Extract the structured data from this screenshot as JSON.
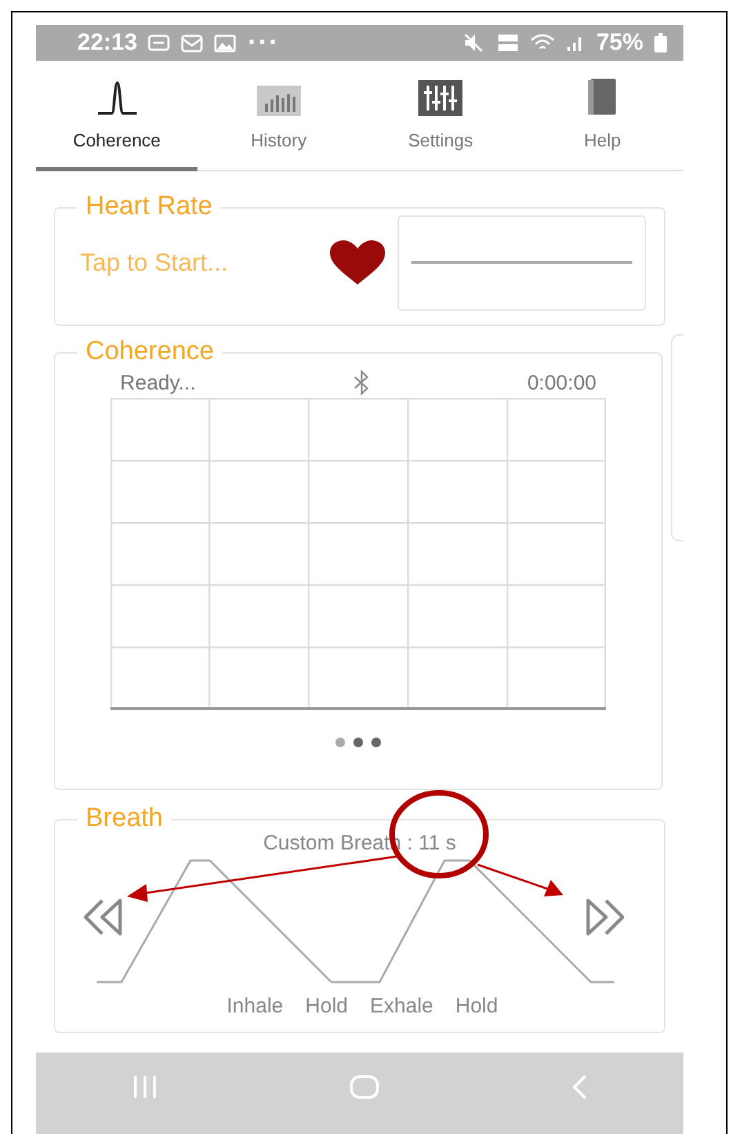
{
  "status_bar": {
    "time": "22:13",
    "more": "···",
    "battery": "75%"
  },
  "tabs": [
    {
      "label": "Coherence",
      "selected": true
    },
    {
      "label": "History",
      "selected": false
    },
    {
      "label": "Settings",
      "selected": false
    },
    {
      "label": "Help",
      "selected": false
    }
  ],
  "heart_rate": {
    "title": "Heart Rate",
    "status": "Tap to Start..."
  },
  "coherence": {
    "title": "Coherence",
    "status": "Ready...",
    "timer": "0:00:00",
    "pages": [
      {
        "selected": true
      },
      {
        "selected": false
      },
      {
        "selected": false
      }
    ]
  },
  "breath": {
    "title": "Breath",
    "pattern": "Custom Breath : 11 s",
    "phases": [
      "Inhale",
      "Hold",
      "Exhale",
      "Hold"
    ]
  }
}
